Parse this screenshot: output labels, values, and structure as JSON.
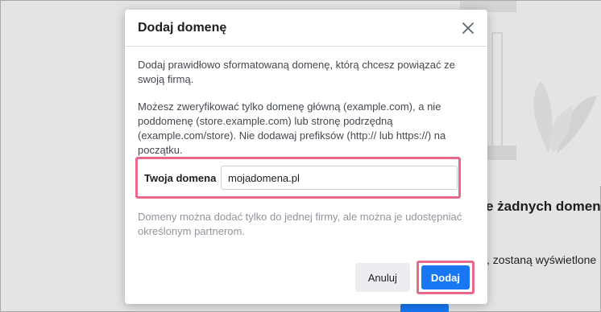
{
  "background": {
    "heading": "e żadnych domen.",
    "text": ", zostaną wyświetlone"
  },
  "modal": {
    "title": "Dodaj domenę",
    "close_icon": "close-icon",
    "description_1": "Dodaj prawidłowo sformatowaną domenę, którą chcesz powiązać ze swoją firmą.",
    "description_2": "Możesz zweryfikować tylko domenę główną (example.com), a nie poddomenę (store.example.com) lub stronę podrzędną (example.com/store). Nie dodawaj prefiksów (http:// lub https://) na początku.",
    "field_label": "Twoja domena",
    "field_value": "mojadomena.pl",
    "hint": "Domeny można dodać tylko do jednej firmy, ale można je udostępniać określonym partnerom.",
    "cancel_label": "Anuluj",
    "submit_label": "Dodaj"
  },
  "colors": {
    "primary": "#1877f2",
    "highlight": "#e8688a",
    "hint": "#90949c"
  }
}
